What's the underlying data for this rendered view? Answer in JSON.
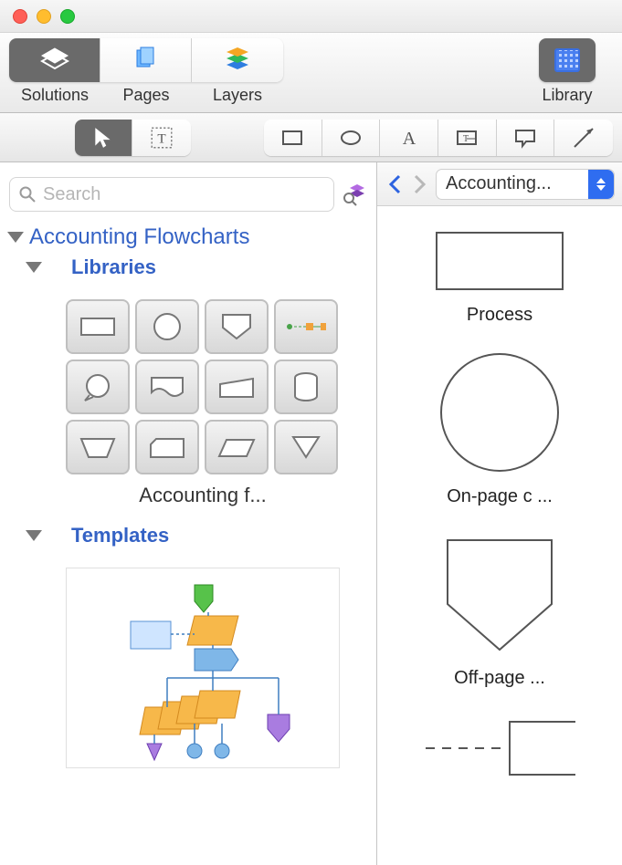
{
  "window": {
    "title": ""
  },
  "toolbar": {
    "solutions": "Solutions",
    "pages": "Pages",
    "layers": "Layers",
    "library": "Library"
  },
  "tools": {
    "pointer": "pointer",
    "text_insert": "text-insert",
    "rect": "rectangle",
    "ellipse": "ellipse",
    "text": "text",
    "textbox": "text-box",
    "callout": "callout",
    "line": "line"
  },
  "left": {
    "search": {
      "placeholder": "Search"
    },
    "category": "Accounting Flowcharts",
    "libraries_label": "Libraries",
    "templates_label": "Templates",
    "library_name": "Accounting f..."
  },
  "right": {
    "selector": "Accounting...",
    "shapes": [
      {
        "label": "Process"
      },
      {
        "label": "On-page c ..."
      },
      {
        "label": "Off-page  ..."
      },
      {
        "label": ""
      }
    ]
  }
}
